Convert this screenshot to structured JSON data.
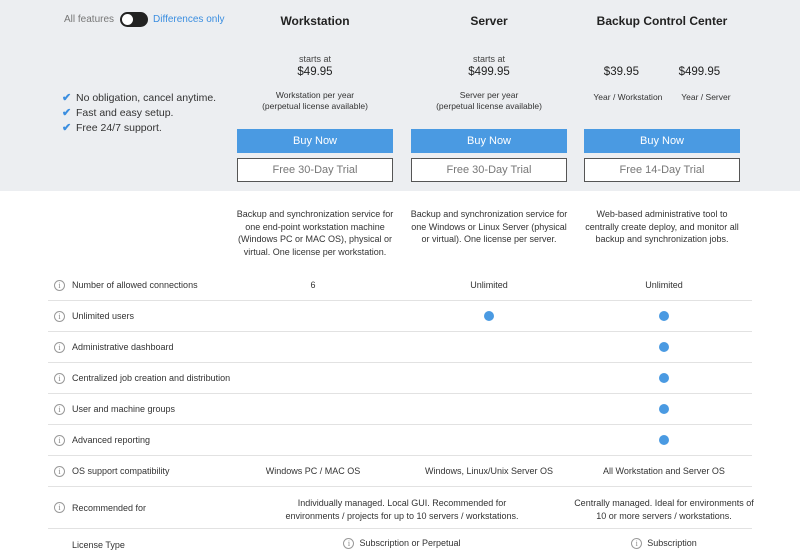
{
  "toggle": {
    "left_label": "All features",
    "right_label": "Differences only"
  },
  "benefits": [
    "No obligation, cancel anytime.",
    "Fast and easy setup.",
    "Free 24/7 support."
  ],
  "columns": [
    {
      "title": "Workstation",
      "starts_at": "starts at",
      "price": "$49.95",
      "per_line1": "Workstation per year",
      "per_line2": "(perpetual license available)",
      "buy_label": "Buy Now",
      "trial_label": "Free 30-Day Trial",
      "description": "Backup and synchronization service for one end-point workstation machine (Windows PC or MAC OS), physical or virtual. One license per workstation."
    },
    {
      "title": "Server",
      "starts_at": "starts at",
      "price": "$499.95",
      "per_line1": "Server per year",
      "per_line2": "(perpetual license available)",
      "buy_label": "Buy Now",
      "trial_label": "Free 30-Day Trial",
      "description": "Backup and synchronization service for one Windows or Linux Server (physical or virtual). One license per server."
    },
    {
      "title": "Backup Control Center",
      "price_a": "$39.95",
      "price_b": "$499.95",
      "per_a": "Year / Workstation",
      "per_b": "Year / Server",
      "buy_label": "Buy Now",
      "trial_label": "Free 14-Day Trial",
      "description": "Web-based administrative tool to centrally create deploy, and monitor all backup and synchronization jobs."
    }
  ],
  "features": {
    "info_glyph": "i",
    "rows": [
      {
        "label": "Number of allowed connections",
        "workstation": "6",
        "server": "Unlimited",
        "bcc": "Unlimited"
      },
      {
        "label": "Unlimited users",
        "workstation": "",
        "server": "dot",
        "bcc": "dot"
      },
      {
        "label": "Administrative dashboard",
        "workstation": "",
        "server": "",
        "bcc": "dot"
      },
      {
        "label": "Centralized job creation and distribution",
        "workstation": "",
        "server": "",
        "bcc": "dot"
      },
      {
        "label": "User and machine groups",
        "workstation": "",
        "server": "",
        "bcc": "dot"
      },
      {
        "label": "Advanced reporting",
        "workstation": "",
        "server": "",
        "bcc": "dot"
      },
      {
        "label": "OS support compatibility",
        "workstation": "Windows PC / MAC OS",
        "server": "Windows, Linux/Unix Server OS",
        "bcc": "All Workstation and Server OS"
      }
    ],
    "recommended": {
      "label": "Recommended for",
      "ws_server_line1": "Individually managed. Local GUI. Recommended for",
      "ws_server_line2": "environments / projects for up to 10 servers / workstations.",
      "bcc_line1": "Centrally managed. Ideal for environments of",
      "bcc_line2": "10 or more servers / workstations."
    },
    "license": {
      "label": "License Type",
      "ws_server": "Subscription or Perpetual",
      "bcc": "Subscription"
    }
  },
  "colors": {
    "accent": "#4a9ae2",
    "header_bg": "#eceef1"
  }
}
